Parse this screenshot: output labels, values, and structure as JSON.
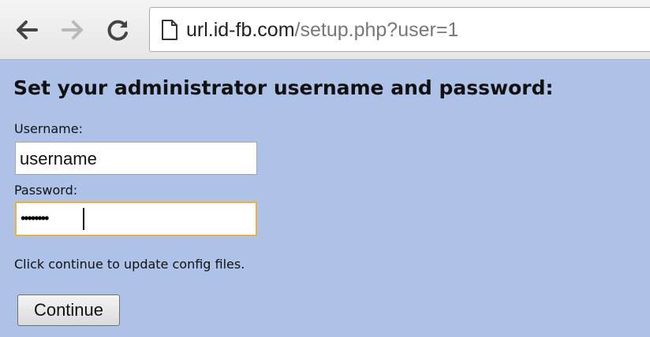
{
  "browser": {
    "back_icon": "arrow-left-icon",
    "forward_icon": "arrow-right-icon",
    "reload_icon": "reload-icon",
    "page_icon": "document-icon",
    "url_host": "url.id-fb.com",
    "url_path": "/setup.php?user=1"
  },
  "form": {
    "heading": "Set your administrator username and password:",
    "username_label": "Username:",
    "username_value": "username",
    "password_label": "Password:",
    "password_masked": "••••••••",
    "note": "Click continue to update config files.",
    "continue_label": "Continue"
  },
  "colors": {
    "page_background": "#aec2e8",
    "focus_border": "#e0b25a"
  }
}
